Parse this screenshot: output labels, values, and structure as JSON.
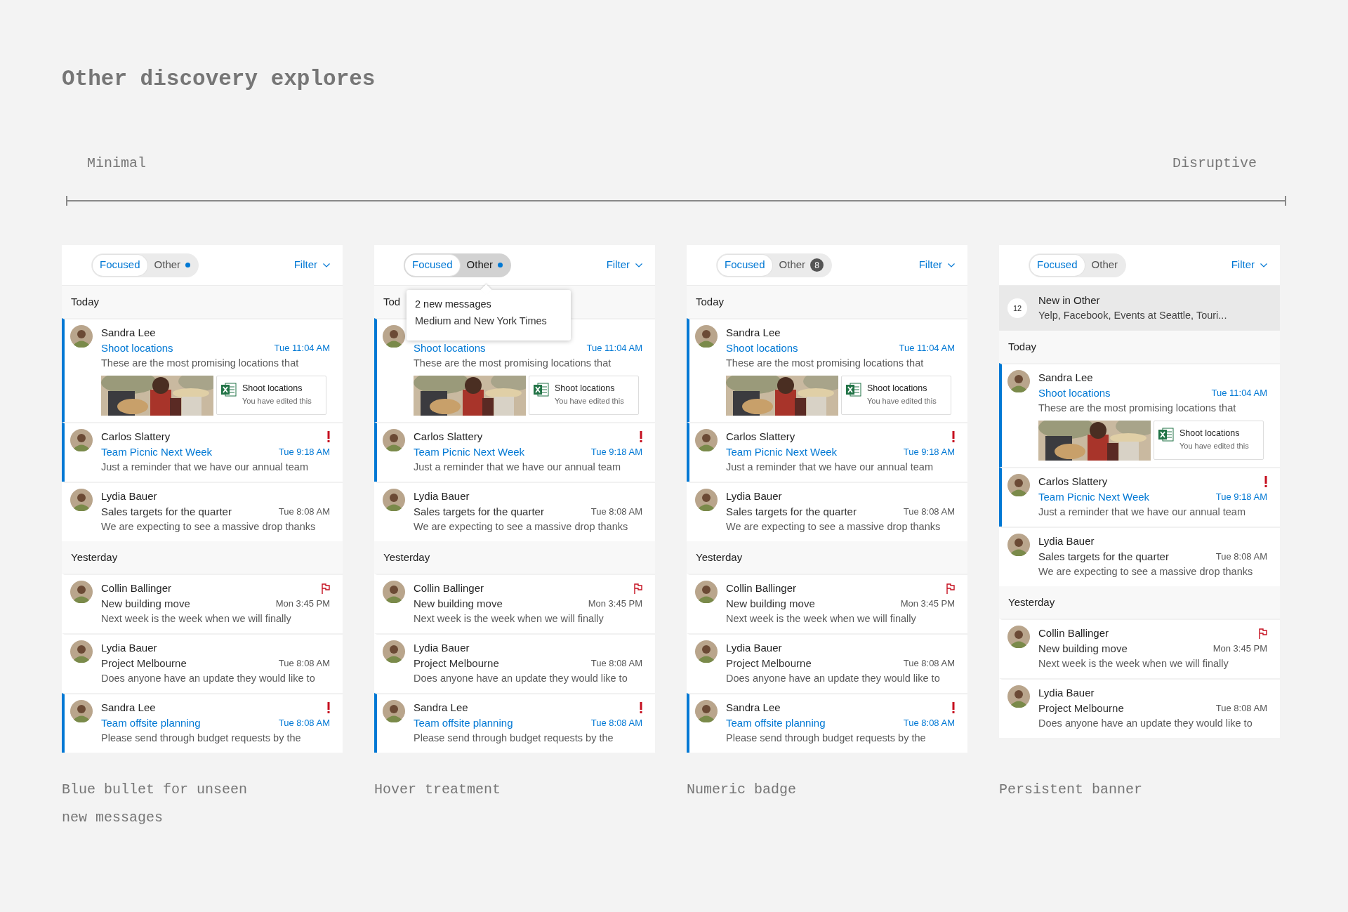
{
  "title": "Other discovery explores",
  "scale": {
    "start": "Minimal",
    "end": "Disruptive"
  },
  "panels": [
    {
      "caption": "Blue bullet for unseen new messages",
      "tabs": [
        {
          "label": "Focused",
          "selected": true,
          "hovered": false
        },
        {
          "label": "Other",
          "selected": false,
          "hovered": false,
          "indicator": {
            "kind": "dot"
          }
        }
      ],
      "filter": "Filter",
      "sections": [
        {
          "label": "Today",
          "messages": [
            {
              "sender": "Sandra Lee",
              "subject": "Shoot locations",
              "time": "Tue 11:04 AM",
              "preview": "These are the most promising locations that",
              "unread": true,
              "attachments": [
                {
                  "kind": "picture"
                },
                {
                  "kind": "file",
                  "title": "Shoot locations",
                  "subtitle": "You have edited this"
                }
              ]
            },
            {
              "sender": "Carlos Slattery",
              "subject": "Team Picnic Next Week",
              "time": "Tue 9:18 AM",
              "preview": "Just a reminder that we have our annual team",
              "unread": true,
              "important": true
            },
            {
              "sender": "Lydia Bauer",
              "subject": "Sales targets for the quarter",
              "time": "Tue 8:08 AM",
              "preview": "We are expecting to see a massive drop thanks",
              "unread": false
            }
          ]
        },
        {
          "label": "Yesterday",
          "messages": [
            {
              "sender": "Collin Ballinger",
              "subject": "New building move",
              "time": "Mon 3:45 PM",
              "preview": "Next week is the week when we will finally",
              "unread": false,
              "flagged": true
            },
            {
              "sender": "Lydia Bauer",
              "subject": "Project Melbourne",
              "time": "Tue 8:08 AM",
              "preview": "Does anyone have an update they would like to",
              "unread": false
            },
            {
              "sender": "Sandra Lee",
              "subject": "Team offsite planning",
              "time": "Tue 8:08 AM",
              "preview": "Please send through budget requests by the",
              "unread": true,
              "important": true
            }
          ]
        }
      ]
    },
    {
      "caption": "Hover treatment",
      "tabs": [
        {
          "label": "Focused",
          "selected": true,
          "hovered": false
        },
        {
          "label": "Other",
          "selected": false,
          "hovered": true,
          "indicator": {
            "kind": "dot"
          }
        }
      ],
      "filter": "Filter",
      "tooltip": {
        "title": "2 new messages",
        "text": "Medium and New York Times"
      },
      "sections": [
        {
          "label": "Tod",
          "messages": [
            {
              "subject": "Shoot locations",
              "time": "Tue 11:04 AM",
              "preview": "These are the most promising locations that",
              "unread": true,
              "attachments": [
                {
                  "kind": "picture"
                },
                {
                  "kind": "file",
                  "title": "Shoot locations",
                  "subtitle": "You have edited this"
                }
              ]
            },
            {
              "sender": "Carlos Slattery",
              "subject": "Team Picnic Next Week",
              "time": "Tue 9:18 AM",
              "preview": "Just a reminder that we have our annual team",
              "unread": true,
              "important": true
            },
            {
              "sender": "Lydia Bauer",
              "subject": "Sales targets for the quarter",
              "time": "Tue 8:08 AM",
              "preview": "We are expecting to see a massive drop thanks",
              "unread": false
            }
          ]
        },
        {
          "label": "Yesterday",
          "messages": [
            {
              "sender": "Collin Ballinger",
              "subject": "New building move",
              "time": "Mon 3:45 PM",
              "preview": "Next week is the week when we will finally",
              "unread": false,
              "flagged": true
            },
            {
              "sender": "Lydia Bauer",
              "subject": "Project Melbourne",
              "time": "Tue 8:08 AM",
              "preview": "Does anyone have an update they would like to",
              "unread": false
            },
            {
              "sender": "Sandra Lee",
              "subject": "Team offsite planning",
              "time": "Tue 8:08 AM",
              "preview": "Please send through budget requests by the",
              "unread": true,
              "important": true
            }
          ]
        }
      ]
    },
    {
      "caption": "Numeric badge",
      "tabs": [
        {
          "label": "Focused",
          "selected": true,
          "hovered": false
        },
        {
          "label": "Other",
          "selected": false,
          "hovered": false,
          "indicator": {
            "kind": "badge",
            "count": "8"
          }
        }
      ],
      "filter": "Filter",
      "sections": [
        {
          "label": "Today",
          "messages": [
            {
              "sender": "Sandra Lee",
              "subject": "Shoot locations",
              "time": "Tue 11:04 AM",
              "preview": "These are the most promising locations that",
              "unread": true,
              "attachments": [
                {
                  "kind": "picture"
                },
                {
                  "kind": "file",
                  "title": "Shoot locations",
                  "subtitle": "You have edited this"
                }
              ]
            },
            {
              "sender": "Carlos Slattery",
              "subject": "Team Picnic Next Week",
              "time": "Tue 9:18 AM",
              "preview": "Just a reminder that we have our annual team",
              "unread": true,
              "important": true
            },
            {
              "sender": "Lydia Bauer",
              "subject": "Sales targets for the quarter",
              "time": "Tue 8:08 AM",
              "preview": "We are expecting to see a massive drop thanks",
              "unread": false
            }
          ]
        },
        {
          "label": "Yesterday",
          "messages": [
            {
              "sender": "Collin Ballinger",
              "subject": "New building move",
              "time": "Mon 3:45 PM",
              "preview": "Next week is the week when we will finally",
              "unread": false,
              "flagged": true
            },
            {
              "sender": "Lydia Bauer",
              "subject": "Project Melbourne",
              "time": "Tue 8:08 AM",
              "preview": "Does anyone have an update they would like to",
              "unread": false
            },
            {
              "sender": "Sandra Lee",
              "subject": "Team offsite planning",
              "time": "Tue 8:08 AM",
              "preview": "Please send through budget requests by the",
              "unread": true,
              "important": true
            }
          ]
        }
      ]
    },
    {
      "caption": "Persistent banner",
      "tabs": [
        {
          "label": "Focused",
          "selected": true,
          "hovered": false
        },
        {
          "label": "Other",
          "selected": false,
          "hovered": false
        }
      ],
      "filter": "Filter",
      "banner": {
        "count": "12",
        "title": "New in Other",
        "text": "Yelp, Facebook, Events at Seattle, Touri..."
      },
      "sections": [
        {
          "label": "Today",
          "messages": [
            {
              "sender": "Sandra Lee",
              "subject": "Shoot locations",
              "time": "Tue 11:04 AM",
              "preview": "These are the most promising locations that",
              "unread": true,
              "attachments": [
                {
                  "kind": "picture"
                },
                {
                  "kind": "file",
                  "title": "Shoot locations",
                  "subtitle": "You have edited this"
                }
              ]
            },
            {
              "sender": "Carlos Slattery",
              "subject": "Team Picnic Next Week",
              "time": "Tue 9:18 AM",
              "preview": "Just a reminder that we have our annual team",
              "unread": true,
              "important": true
            },
            {
              "sender": "Lydia Bauer",
              "subject": "Sales targets for the quarter",
              "time": "Tue 8:08 AM",
              "preview": "We are expecting to see a massive drop thanks",
              "unread": false
            }
          ]
        },
        {
          "label": "Yesterday",
          "messages": [
            {
              "sender": "Collin Ballinger",
              "subject": "New building move",
              "time": "Mon 3:45 PM",
              "preview": "Next week is the week when we will finally",
              "unread": false,
              "flagged": true
            },
            {
              "sender": "Lydia Bauer",
              "subject": "Project Melbourne",
              "time": "Tue 8:08 AM",
              "preview": "Does anyone have an update they would like to",
              "unread": false
            }
          ]
        }
      ]
    }
  ]
}
